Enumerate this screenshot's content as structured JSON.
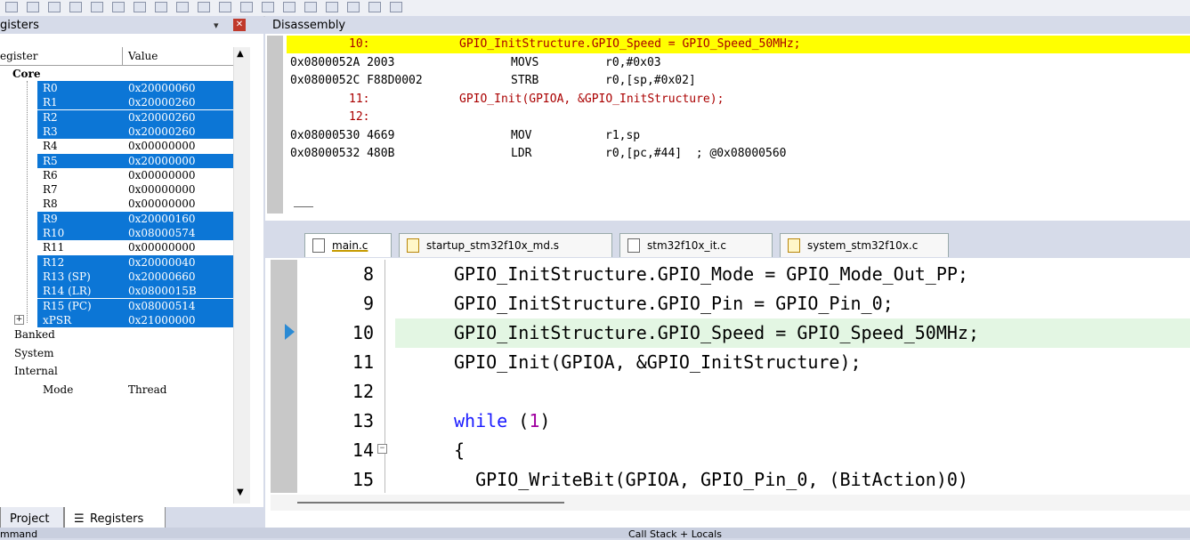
{
  "toolbar": {
    "icons": [
      "view-icon",
      "reset-icon",
      "run-icon",
      "step-icon",
      "step-over-icon",
      "step-out-icon",
      "run-to-cursor-icon",
      "command-window-icon",
      "disassembly-window-icon",
      "symbols-window-icon",
      "registers-window-icon",
      "call-stack-icon",
      "watch-window-icon",
      "memory-window-icon",
      "serial-window-icon",
      "analysis-window-icon",
      "trace-icon",
      "system-viewer-icon",
      "toolbox-icon"
    ]
  },
  "registers_panel": {
    "title": "gisters",
    "col_register": "egister",
    "col_value": "Value",
    "core_label": "Core",
    "registers": [
      {
        "name": "R0",
        "value": "0x20000060",
        "selected": true
      },
      {
        "name": "R1",
        "value": "0x20000260",
        "selected": true
      },
      {
        "name": "R2",
        "value": "0x20000260",
        "selected": true
      },
      {
        "name": "R3",
        "value": "0x20000260",
        "selected": true
      },
      {
        "name": "R4",
        "value": "0x00000000",
        "selected": false
      },
      {
        "name": "R5",
        "value": "0x20000000",
        "selected": true
      },
      {
        "name": "R6",
        "value": "0x00000000",
        "selected": false
      },
      {
        "name": "R7",
        "value": "0x00000000",
        "selected": false
      },
      {
        "name": "R8",
        "value": "0x00000000",
        "selected": false
      },
      {
        "name": "R9",
        "value": "0x20000160",
        "selected": true
      },
      {
        "name": "R10",
        "value": "0x08000574",
        "selected": true
      },
      {
        "name": "R11",
        "value": "0x00000000",
        "selected": false
      },
      {
        "name": "R12",
        "value": "0x20000040",
        "selected": true
      },
      {
        "name": "R13 (SP)",
        "value": "0x20000660",
        "selected": true
      },
      {
        "name": "R14 (LR)",
        "value": "0x0800015B",
        "selected": true
      },
      {
        "name": "R15 (PC)",
        "value": "0x08000514",
        "selected": true
      },
      {
        "name": "xPSR",
        "value": "0x21000000",
        "selected": true
      }
    ],
    "groups": [
      "Banked",
      "System",
      "Internal"
    ],
    "mode_label": "Mode",
    "mode_value": "Thread",
    "tab_project": "Project",
    "tab_registers": "Registers"
  },
  "disassembly": {
    "title": "Disassembly",
    "lines": [
      {
        "kind": "src",
        "ln": "10:",
        "text": "GPIO_InitStructure.GPIO_Speed = GPIO_Speed_50MHz;",
        "highlight": true
      },
      {
        "kind": "asm",
        "addr": "0x0800052A 2003",
        "op": "MOVS",
        "arg": "r0,#0x03"
      },
      {
        "kind": "asm",
        "addr": "0x0800052C F88D0002",
        "op": "STRB",
        "arg": "r0,[sp,#0x02]"
      },
      {
        "kind": "src",
        "ln": "11:",
        "text": "GPIO_Init(GPIOA, &GPIO_InitStructure);",
        "highlight": false
      },
      {
        "kind": "src",
        "ln": "12:",
        "text": "",
        "highlight": false
      },
      {
        "kind": "asm",
        "addr": "0x08000530 4669",
        "op": "MOV",
        "arg": "r1,sp"
      },
      {
        "kind": "asm",
        "addr": "0x08000532 480B",
        "op": "LDR",
        "arg": "r0,[pc,#44]  ; @0x08000560"
      }
    ]
  },
  "editor": {
    "tabs": [
      {
        "label": "main.c",
        "active": true,
        "kind": "c"
      },
      {
        "label": "startup_stm32f10x_md.s",
        "active": false,
        "kind": "s"
      },
      {
        "label": "stm32f10x_it.c",
        "active": false,
        "kind": "c"
      },
      {
        "label": "system_stm32f10x.c",
        "active": false,
        "kind": "s"
      }
    ],
    "lines": [
      {
        "num": "8",
        "code": "GPIO_InitStructure.GPIO_Mode = GPIO_Mode_Out_PP;"
      },
      {
        "num": "9",
        "code": "GPIO_InitStructure.GPIO_Pin = GPIO_Pin_0;"
      },
      {
        "num": "10",
        "code": "GPIO_InitStructure.GPIO_Speed = GPIO_Speed_50MHz;"
      },
      {
        "num": "11",
        "code": "GPIO_Init(GPIOA, &GPIO_InitStructure);"
      },
      {
        "num": "12",
        "code": ""
      },
      {
        "num": "13",
        "kw": "while",
        "rest_a": " (",
        "lit": "1",
        "rest_b": ")"
      },
      {
        "num": "14",
        "code": "{"
      },
      {
        "num": "15",
        "code": "  GPIO_WriteBit(GPIOA, GPIO_Pin_0, (BitAction)0)"
      }
    ]
  },
  "bottom": {
    "command_label": "mmand",
    "callstack_label": "Call Stack + Locals"
  }
}
